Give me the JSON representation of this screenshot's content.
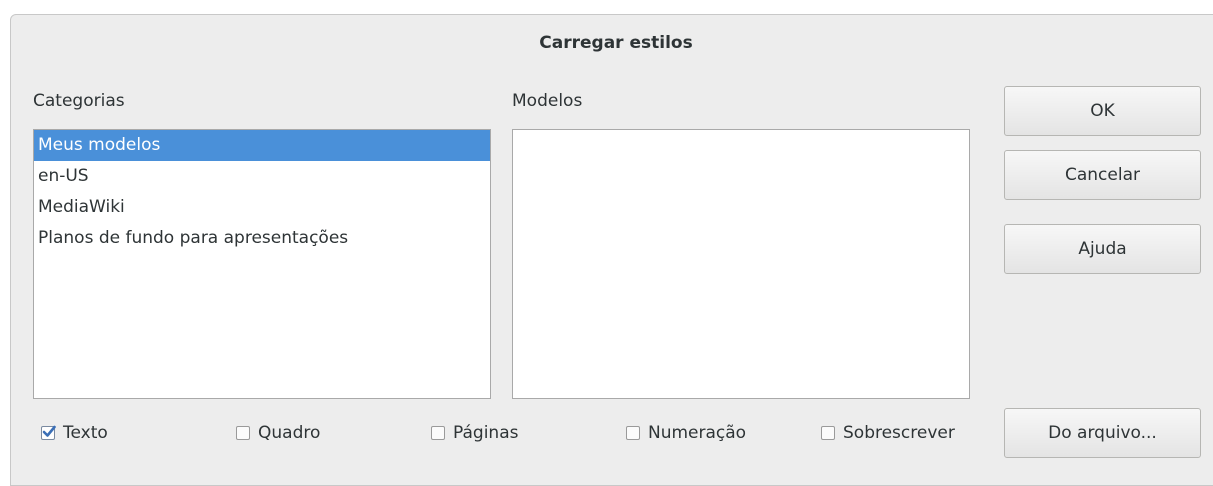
{
  "dialog": {
    "title": "Carregar estilos"
  },
  "categories": {
    "label": "Categorias",
    "items": [
      {
        "label": "Meus modelos",
        "selected": true
      },
      {
        "label": "en-US",
        "selected": false
      },
      {
        "label": "MediaWiki",
        "selected": false
      },
      {
        "label": "Planos de fundo para apresentações",
        "selected": false
      }
    ]
  },
  "templates": {
    "label": "Modelos",
    "items": []
  },
  "buttons": {
    "ok": "OK",
    "cancel": "Cancelar",
    "help": "Ajuda",
    "from_file": "Do arquivo..."
  },
  "options": {
    "text": {
      "label": "Texto",
      "checked": true
    },
    "frame": {
      "label": "Quadro",
      "checked": false
    },
    "pages": {
      "label": "Páginas",
      "checked": false
    },
    "numbering": {
      "label": "Numeração",
      "checked": false
    },
    "overwrite": {
      "label": "Sobrescrever",
      "checked": false
    }
  },
  "colors": {
    "selection": "#4a90d9",
    "dialog_bg": "#ededed",
    "check_accent": "#3b6fb6"
  }
}
